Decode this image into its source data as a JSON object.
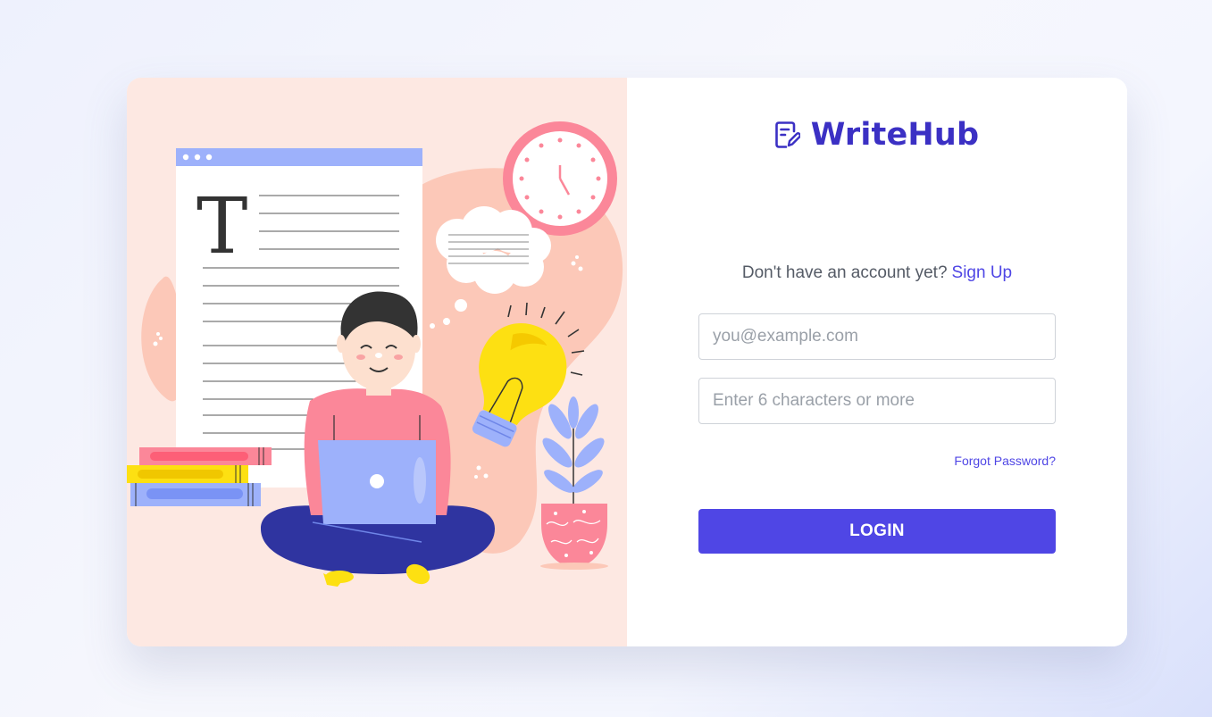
{
  "brand": {
    "name": "WriteHub",
    "icon": "pencil-document-icon",
    "color": "#3b30c4"
  },
  "illustration": {
    "letter": "T",
    "description_icon": "person-writing-on-laptop-illustration"
  },
  "signup": {
    "prompt": "Don't have an account yet?",
    "link_label": "Sign Up"
  },
  "form": {
    "email_placeholder": "you@example.com",
    "email_value": "",
    "password_placeholder": "Enter 6 characters or more",
    "password_value": "",
    "forgot_label": "Forgot Password?",
    "login_label": "LOGIN"
  },
  "colors": {
    "accent": "#4f46e5",
    "panel_bg": "#fde8e2"
  }
}
